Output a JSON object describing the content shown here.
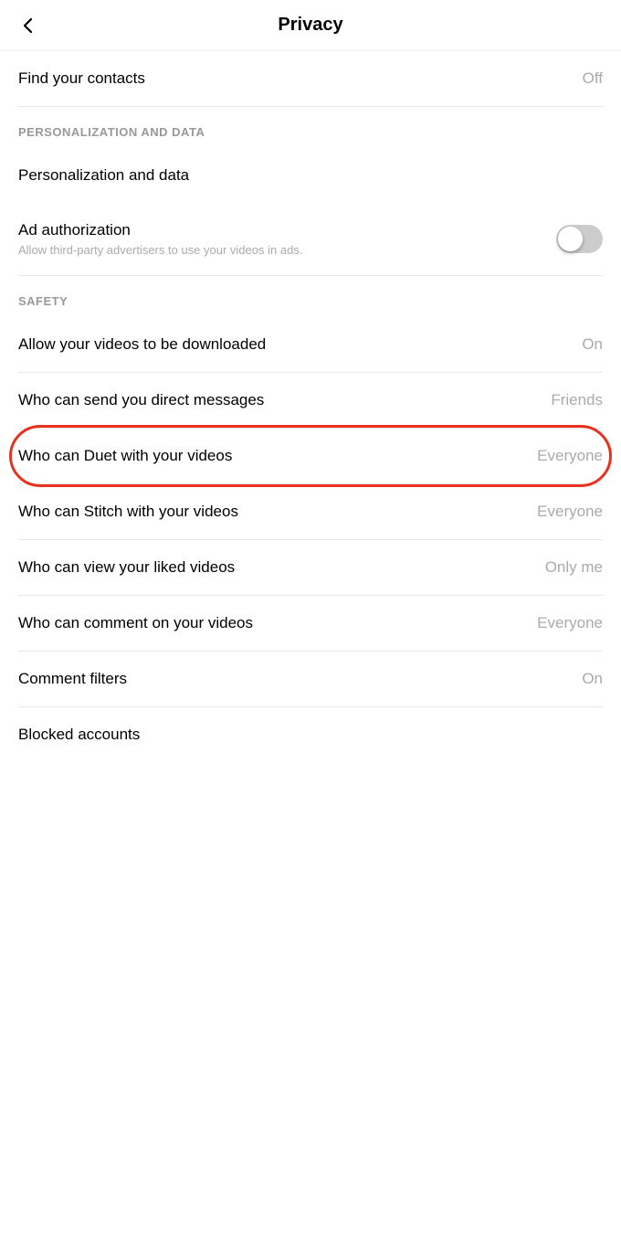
{
  "header": {
    "title": "Privacy",
    "back_label": "←"
  },
  "settings": {
    "find_contacts": {
      "label": "Find your contacts",
      "value": "Off"
    },
    "sections": {
      "personalization_header": "PERSONALIZATION AND DATA",
      "safety_header": "SAFETY"
    },
    "personalization": {
      "label": "Personalization and data",
      "value": ""
    },
    "ad_authorization": {
      "label": "Ad authorization",
      "sublabel": "Allow third-party advertisers to use your videos in ads.",
      "toggle_state": "off"
    },
    "allow_downloads": {
      "label": "Allow your videos to be downloaded",
      "value": "On"
    },
    "direct_messages": {
      "label": "Who can send you direct messages",
      "value": "Friends"
    },
    "duet": {
      "label": "Who can Duet with your videos",
      "value": "Everyone"
    },
    "stitch": {
      "label": "Who can Stitch with your videos",
      "value": "Everyone"
    },
    "liked_videos": {
      "label": "Who can view your liked videos",
      "value": "Only me"
    },
    "comment": {
      "label": "Who can comment on your videos",
      "value": "Everyone"
    },
    "comment_filters": {
      "label": "Comment filters",
      "value": "On"
    },
    "blocked_accounts": {
      "label": "Blocked accounts",
      "value": ""
    }
  }
}
